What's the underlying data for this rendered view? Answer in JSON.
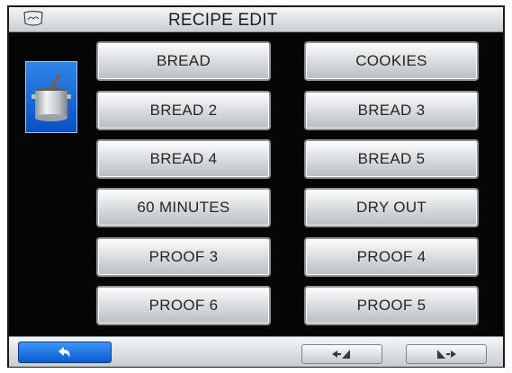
{
  "header": {
    "title": "RECIPE EDIT",
    "logo_icon": "brand-logo-icon"
  },
  "sidebar": {
    "icon": "stock-pot-icon",
    "tile_color": "#1e6fe0"
  },
  "recipes": {
    "left": [
      "BREAD",
      "BREAD 2",
      "BREAD 4",
      "60 MINUTES",
      "PROOF 3",
      "PROOF 6"
    ],
    "right": [
      "COOKIES",
      "BREAD 3",
      "BREAD 5",
      "DRY OUT",
      "PROOF 4",
      "PROOF 5"
    ]
  },
  "footer": {
    "back_icon": "return-arrow-icon",
    "prev_icon": "page-previous-icon",
    "next_icon": "page-next-icon",
    "accent": "#1565d8"
  }
}
